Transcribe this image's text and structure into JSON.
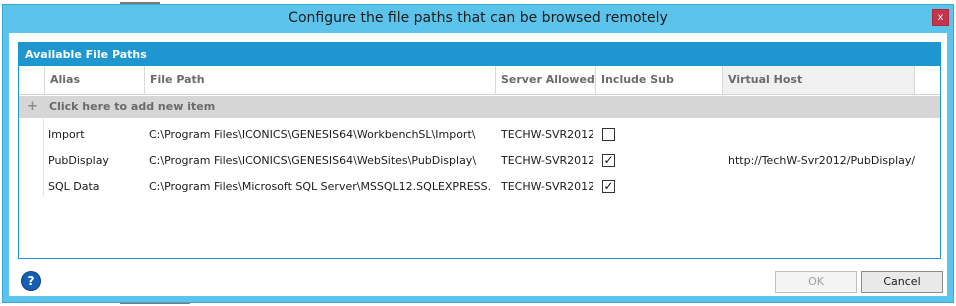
{
  "dialog": {
    "title": "Configure the file paths that can be browsed remotely",
    "close_glyph": "x"
  },
  "panel": {
    "header": "Available File Paths"
  },
  "grid": {
    "columns": [
      "Alias",
      "File Path",
      "Server Allowed",
      "Include Sub Folders",
      "Virtual Host"
    ],
    "add_item_text": "Click here to add new item",
    "add_item_icon": "plus-icon",
    "rows": [
      {
        "alias": "Import",
        "file_path": "C:\\Program Files\\ICONICS\\GENESIS64\\WorkbenchSL\\Import\\",
        "server_allowed": "TECHW-SVR2012",
        "include_sub_folders": false,
        "virtual_host": ""
      },
      {
        "alias": "PubDisplay",
        "file_path": "C:\\Program Files\\ICONICS\\GENESIS64\\WebSites\\PubDisplay\\",
        "server_allowed": "TECHW-SVR2012",
        "include_sub_folders": true,
        "virtual_host": "http://TechW-Svr2012/PubDisplay/"
      },
      {
        "alias": "SQL Data",
        "file_path": "C:\\Program Files\\Microsoft SQL Server\\MSSQL12.SQLEXPRESS...",
        "server_allowed": "TECHW-SVR2012",
        "include_sub_folders": true,
        "virtual_host": ""
      }
    ]
  },
  "footer": {
    "help_icon": "help-icon",
    "help_glyph": "?",
    "ok_label": "OK",
    "ok_enabled": false,
    "cancel_label": "Cancel"
  },
  "colors": {
    "title_bar": "#5cc3ea",
    "panel_header": "#1e97d0",
    "add_row": "#d6d6d6",
    "help_icon": "#1560b5"
  }
}
